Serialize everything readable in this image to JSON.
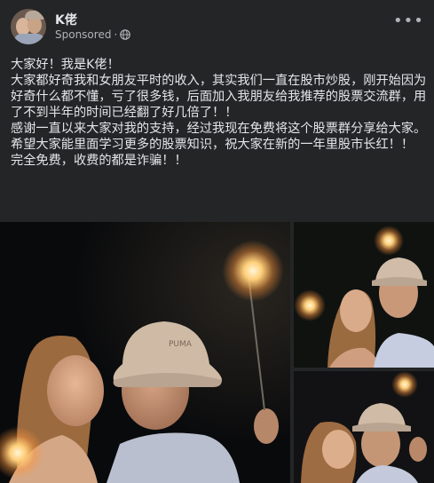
{
  "post": {
    "author_name": "K佬",
    "sponsored_label": "Sponsored",
    "separator": "·",
    "more_label": "•••",
    "text_lines": [
      "大家好！我是K佬！",
      "大家都好奇我和女朋友平时的收入，其实我们一直在股市炒股，刚开始因为好奇什么都不懂，亏了很多钱，后面加入我朋友给我推荐的股票交流群，用了不到半年的时间已经翻了好几倍了！！",
      "感谢一直以来大家对我的支持，经过我现在免费将这个股票群分享给大家。",
      "希望大家能里面学习更多的股票知识，祝大家在新的一年里股市长红！！",
      "完全免费，收费的都是诈骗！！"
    ],
    "hat_brand": "PUMA"
  },
  "colors": {
    "background": "#242526",
    "primary_text": "#e4e6eb",
    "secondary_text": "#b0b3b8"
  },
  "icons": {
    "globe": "globe-icon",
    "more": "more-options-icon"
  }
}
